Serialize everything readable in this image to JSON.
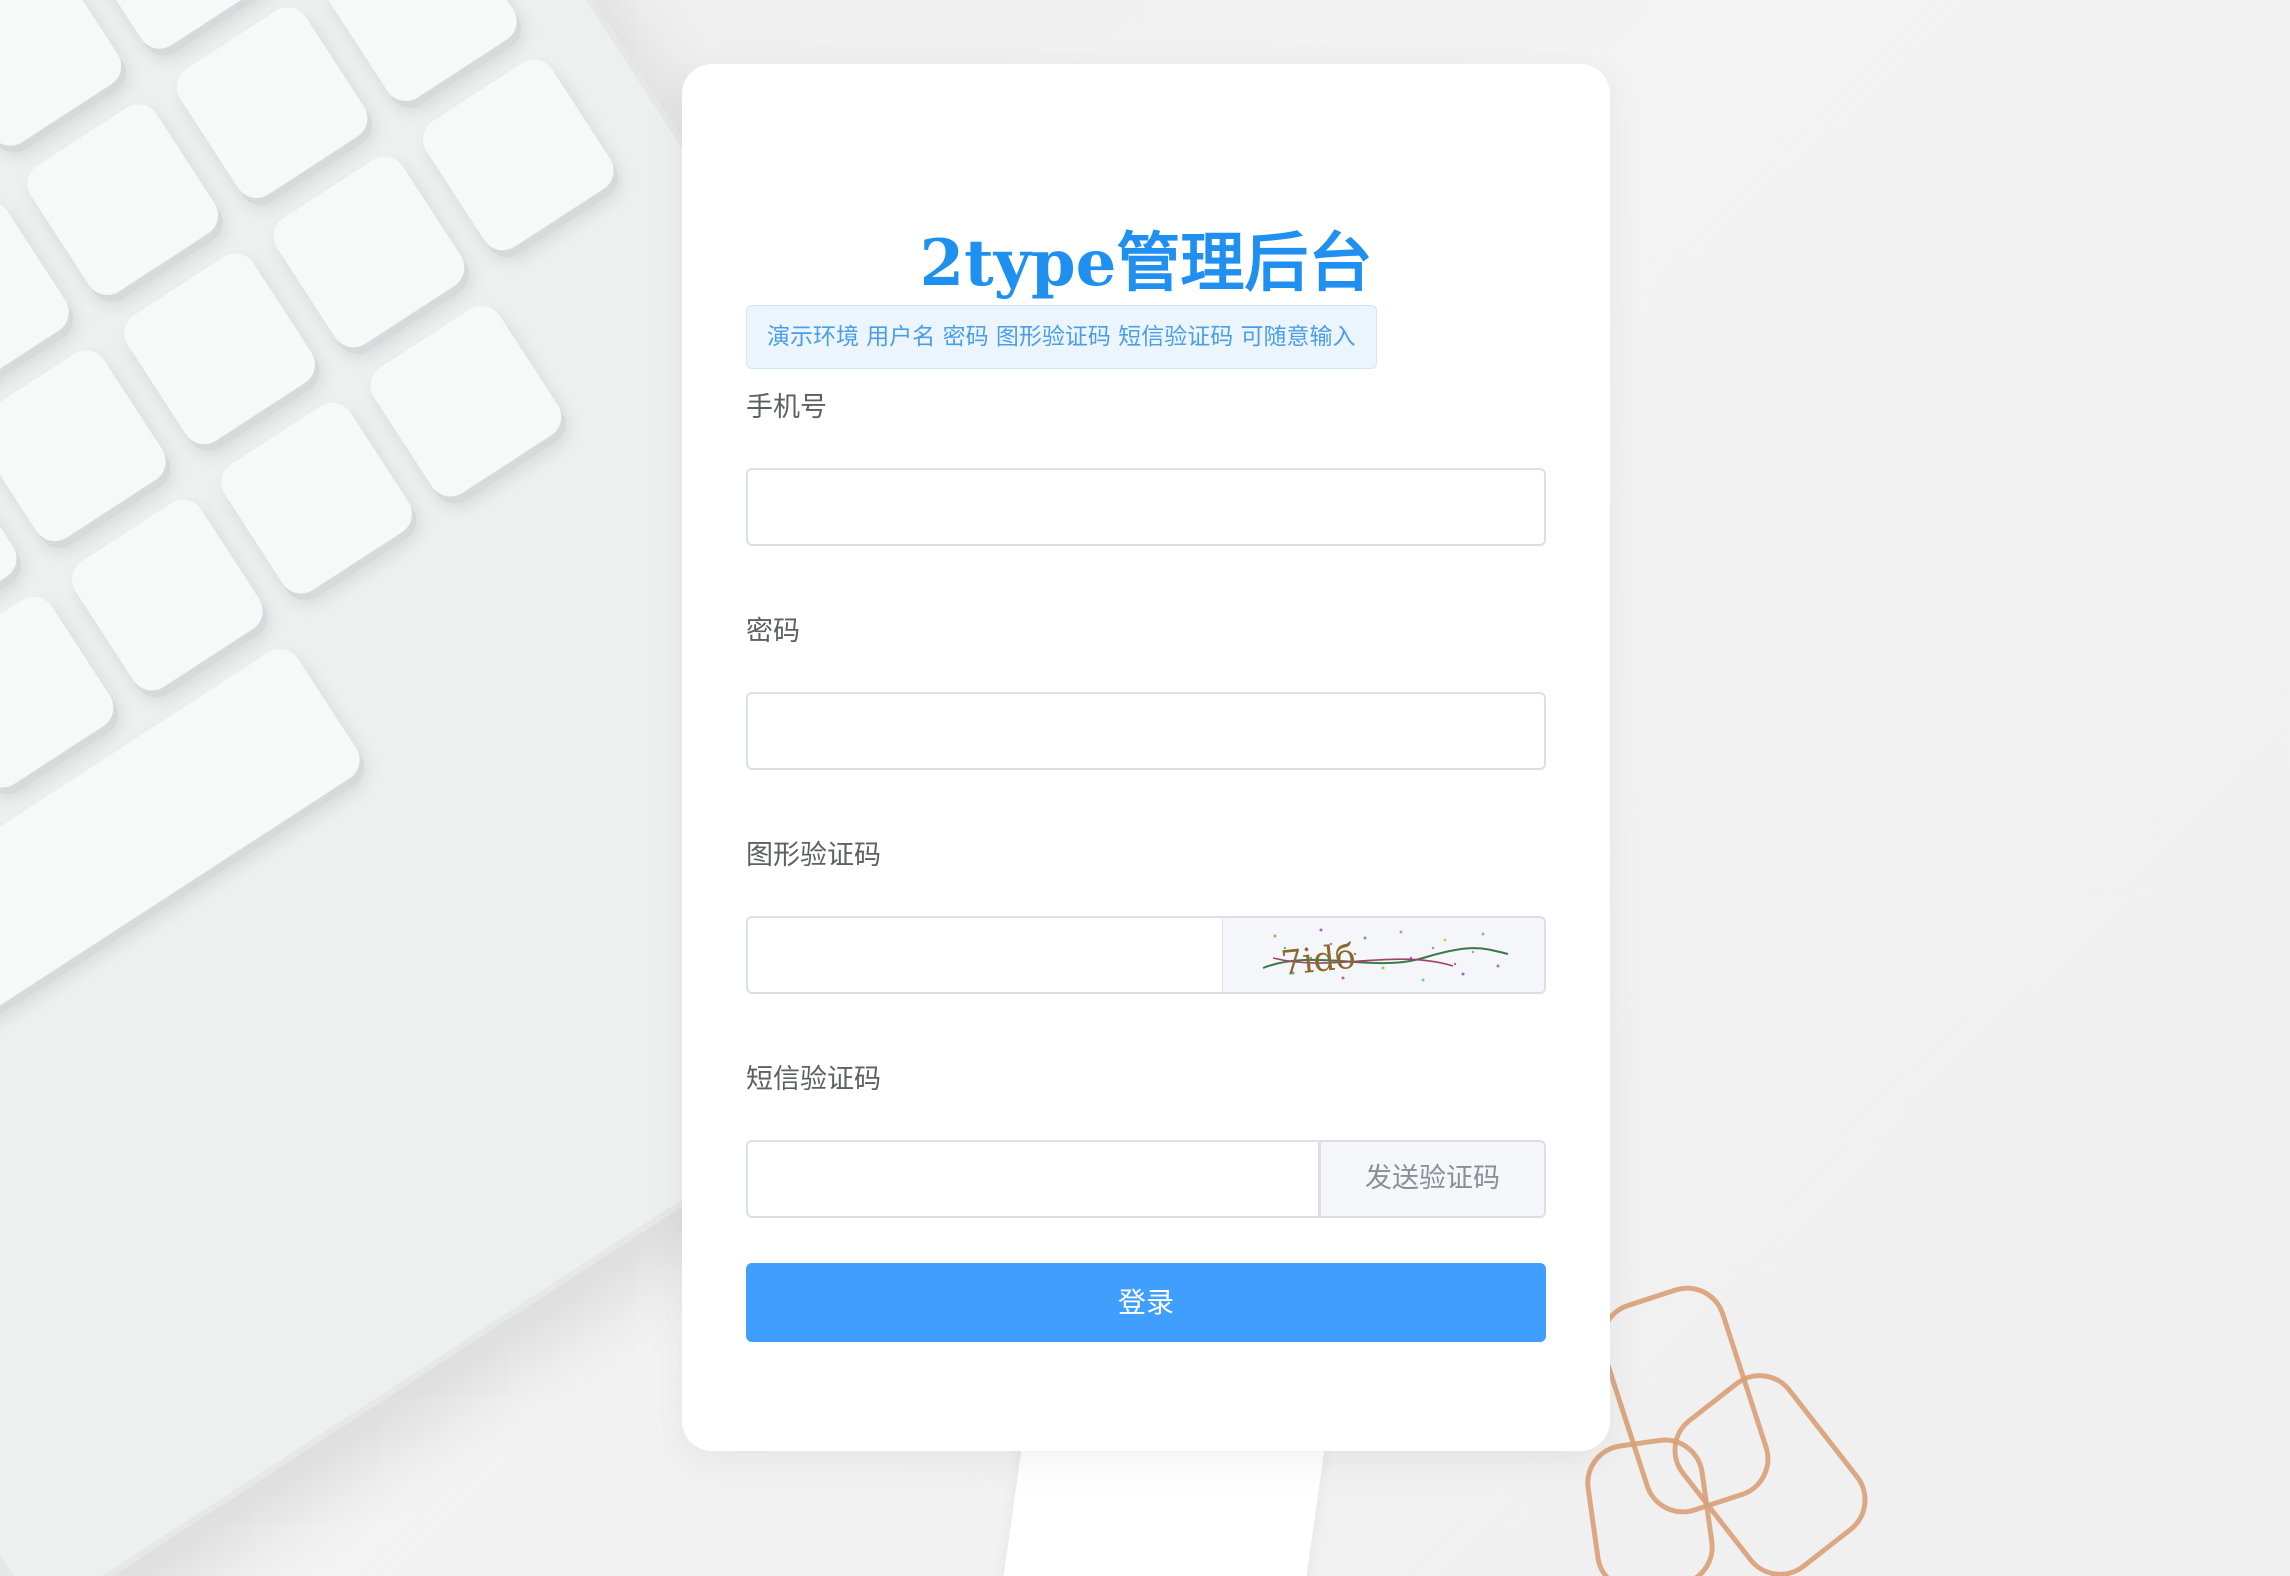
{
  "app": {
    "title": "2type管理后台",
    "notice": "演示环境 用户名 密码 图形验证码 短信验证码 可随意输入"
  },
  "form": {
    "phone": {
      "label": "手机号",
      "value": "",
      "placeholder": ""
    },
    "password": {
      "label": "密码",
      "value": "",
      "placeholder": ""
    },
    "captcha": {
      "label": "图形验证码",
      "value": "",
      "placeholder": "",
      "image_text": "7idб"
    },
    "sms": {
      "label": "短信验证码",
      "value": "",
      "placeholder": "",
      "send_label": "发送验证码"
    },
    "login_label": "登录"
  },
  "colors": {
    "accent": "#409eff",
    "title": "#1f8ff0",
    "notice_bg": "#ecf5fe",
    "notice_text": "#4a9ee8"
  },
  "background": {
    "keyboard_keys": [
      "",
      "",
      "",
      "",
      "",
      "",
      "",
      "",
      "",
      "",
      "",
      "",
      "",
      "",
      "",
      "",
      "",
      "",
      "",
      "",
      "",
      "",
      "",
      "",
      "",
      "",
      "",
      "",
      "",
      "",
      "",
      "",
      "",
      "",
      "",
      "",
      "",
      ""
    ]
  },
  "icons": {
    "captcha": "captcha-image-icon"
  }
}
